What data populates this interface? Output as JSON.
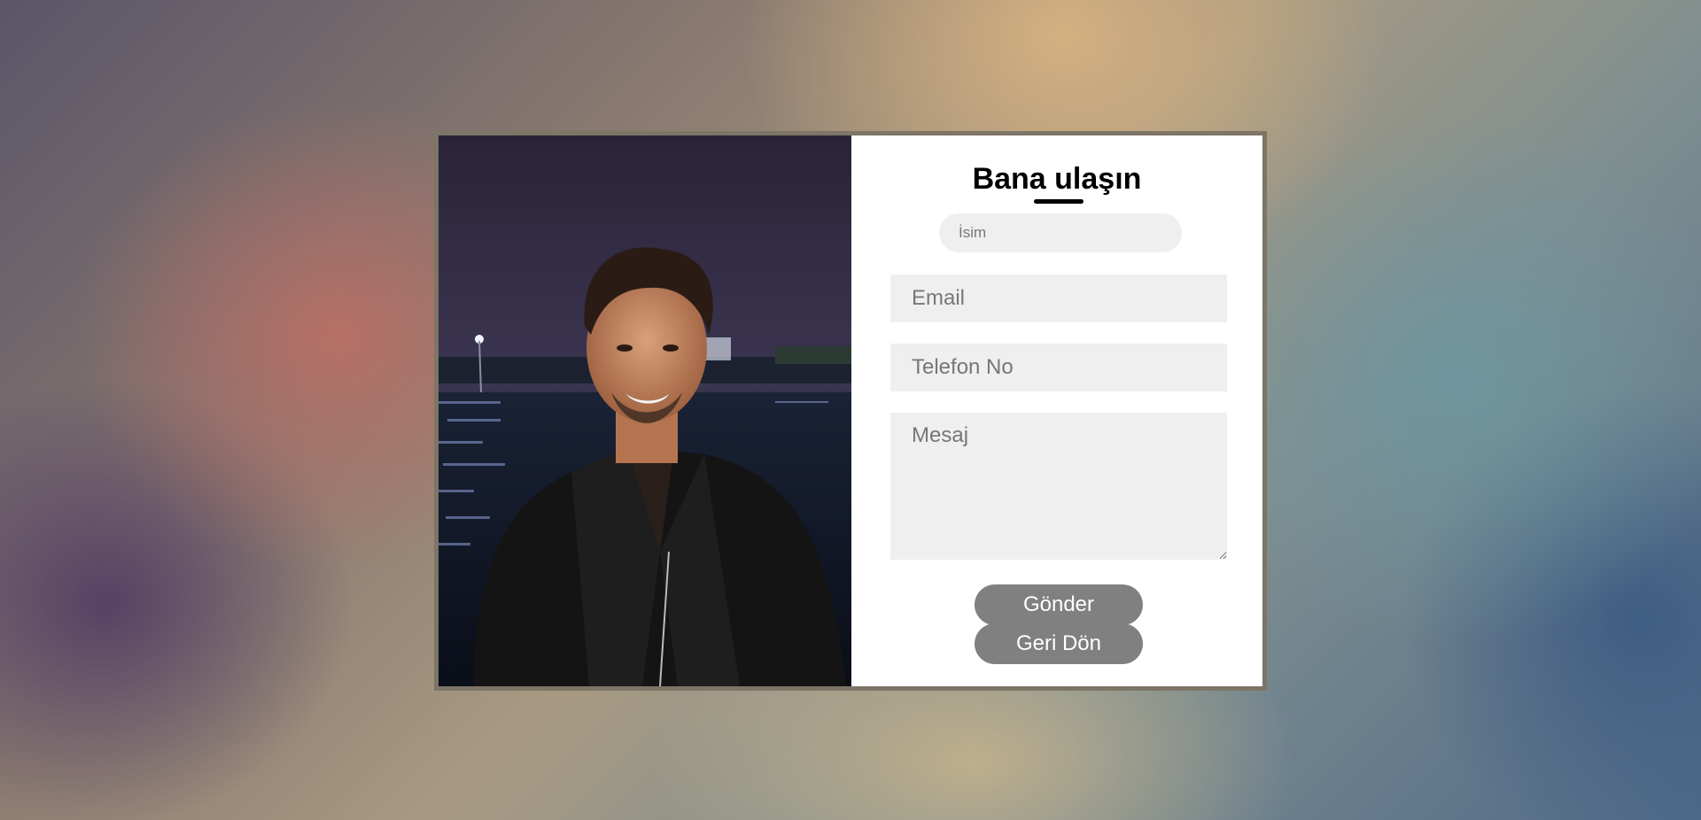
{
  "contact": {
    "title": "Bana ulaşın",
    "name_placeholder": "İsim",
    "email_placeholder": "Email",
    "phone_placeholder": "Telefon No",
    "message_placeholder": "Mesaj",
    "send_label": "Gönder",
    "back_label": "Geri Dön"
  },
  "photo": {
    "subject": "portrait-photo"
  }
}
